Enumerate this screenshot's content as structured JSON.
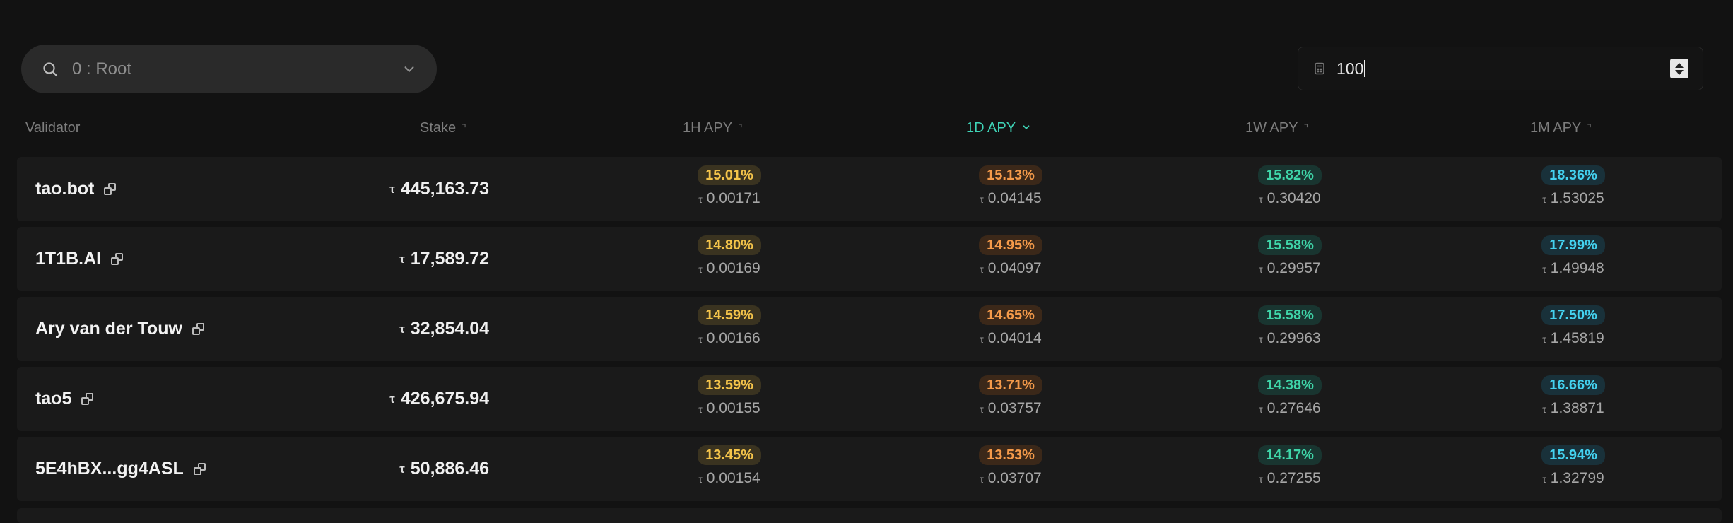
{
  "controls": {
    "subnet_select": {
      "label": "0 : Root"
    },
    "amount_input": {
      "value": "100"
    }
  },
  "table": {
    "headers": {
      "validator": "Validator",
      "stake": "Stake",
      "apy_1h": "1H APY",
      "apy_1d": "1D APY",
      "apy_1w": "1W APY",
      "apy_1m": "1M APY"
    },
    "active_sort": "1D APY",
    "currency_symbol": "τ",
    "rows": [
      {
        "validator": "tao.bot",
        "stake": "445,163.73",
        "h_pct": "15.01%",
        "h_val": "0.00171",
        "d_pct": "15.13%",
        "d_val": "0.04145",
        "w_pct": "15.82%",
        "w_val": "0.30420",
        "m_pct": "18.36%",
        "m_val": "1.53025"
      },
      {
        "validator": "1T1B.AI",
        "stake": "17,589.72",
        "h_pct": "14.80%",
        "h_val": "0.00169",
        "d_pct": "14.95%",
        "d_val": "0.04097",
        "w_pct": "15.58%",
        "w_val": "0.29957",
        "m_pct": "17.99%",
        "m_val": "1.49948"
      },
      {
        "validator": "Ary van der Touw",
        "stake": "32,854.04",
        "h_pct": "14.59%",
        "h_val": "0.00166",
        "d_pct": "14.65%",
        "d_val": "0.04014",
        "w_pct": "15.58%",
        "w_val": "0.29963",
        "m_pct": "17.50%",
        "m_val": "1.45819"
      },
      {
        "validator": "tao5",
        "stake": "426,675.94",
        "h_pct": "13.59%",
        "h_val": "0.00155",
        "d_pct": "13.71%",
        "d_val": "0.03757",
        "w_pct": "14.38%",
        "w_val": "0.27646",
        "m_pct": "16.66%",
        "m_val": "1.38871"
      },
      {
        "validator": "5E4hBX...gg4ASL",
        "stake": "50,886.46",
        "h_pct": "13.45%",
        "h_val": "0.00154",
        "d_pct": "13.53%",
        "d_val": "0.03707",
        "w_pct": "14.17%",
        "w_val": "0.27255",
        "m_pct": "15.94%",
        "m_val": "1.32799"
      }
    ]
  },
  "colors": {
    "background": "#121212",
    "row_background": "#1a1a1a",
    "accent_active_sort": "#3fd5b8",
    "apy_1h": "#f4c44a",
    "apy_1d": "#f49a4a",
    "apy_1w": "#3fd5a8",
    "apy_1m": "#44d2f0"
  },
  "icons": {
    "search": "search-icon",
    "dropdown": "chevron-down-icon",
    "calculator": "calculator-icon",
    "copy": "copy-icon",
    "sort": "sort-icon"
  }
}
